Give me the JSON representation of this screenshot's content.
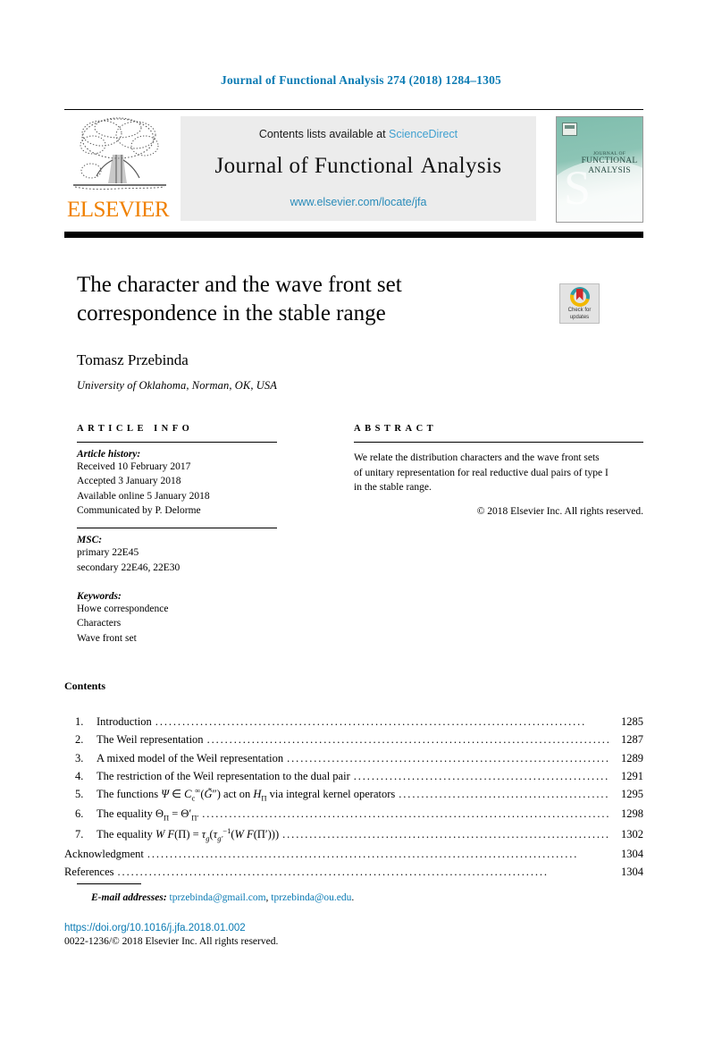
{
  "running_head": "Journal of Functional Analysis 274 (2018) 1284–1305",
  "masthead": {
    "publisher_logo_label": "ELSEVIER",
    "contents_line_prefix": "Contents lists available at ",
    "sciencedirect_link": "ScienceDirect",
    "journal_title_part1": "Journal of Functional",
    "journal_title_part2": "Analysis",
    "journal_url": "www.elsevier.com/locate/jfa",
    "cover": {
      "line1": "JOURNAL OF",
      "line2": "FUNCTIONAL",
      "line3": "ANALYSIS"
    },
    "link_color": "#3fa0d0",
    "band_color": "#ececec"
  },
  "article": {
    "title_line1": "The character and the wave front set",
    "title_line2": "correspondence in the stable range",
    "author": "Tomasz Przebinda",
    "affiliation": "University of Oklahoma, Norman, OK, USA",
    "crossmark_line1": "Check for",
    "crossmark_line2": "updates"
  },
  "article_info": {
    "heading": "ARTICLE INFO",
    "history_label": "Article history:",
    "history": [
      "Received 10 February 2017",
      "Accepted 3 January 2018",
      "Available online 5 January 2018",
      "Communicated by P. Delorme"
    ],
    "msc_label": "MSC:",
    "msc": [
      "primary 22E45",
      "secondary 22E46, 22E30"
    ],
    "keywords_label": "Keywords:",
    "keywords": [
      "Howe correspondence",
      "Characters",
      "Wave front set"
    ]
  },
  "abstract": {
    "heading": "ABSTRACT",
    "line1": "We relate the distribution characters and the wave front sets",
    "line2": "of unitary representation for real reductive dual pairs of type I",
    "line3": "in the stable range.",
    "copyright": "© 2018 Elsevier Inc. All rights reserved."
  },
  "contents": {
    "heading": "Contents",
    "items": [
      {
        "num": "1.",
        "label": "Introduction",
        "page": "1285"
      },
      {
        "num": "2.",
        "label": "The Weil representation",
        "page": "1287"
      },
      {
        "num": "3.",
        "label": "A mixed model of the Weil representation",
        "page": "1289"
      },
      {
        "num": "4.",
        "label": "The restriction of the Weil representation to the dual pair",
        "page": "1291"
      },
      {
        "num": "5.",
        "label": "The functions Ψ ∈ C∞c(G̃″) act on HΠ via integral kernel operators",
        "page": "1295"
      },
      {
        "num": "6.",
        "label": "The equality ΘΠ = Θ′Π′",
        "page": "1298"
      },
      {
        "num": "7.",
        "label": "The equality WF(Π) = τg(τ⁻¹g′(WF(Π′)))",
        "page": "1302"
      },
      {
        "num": "",
        "label": "Acknowledgment",
        "page": "1304"
      },
      {
        "num": "",
        "label": "References",
        "page": "1304"
      }
    ]
  },
  "footer": {
    "email_label": "E-mail addresses:",
    "email1": "tprzebinda@gmail.com",
    "email2": "tprzebinda@ou.edu",
    "email_separator": ", ",
    "email_end": ".",
    "doi": "https://doi.org/10.1016/j.jfa.2018.01.002",
    "issn_line": "0022-1236/© 2018 Elsevier Inc. All rights reserved.",
    "link_color": "#0a7ab3"
  }
}
